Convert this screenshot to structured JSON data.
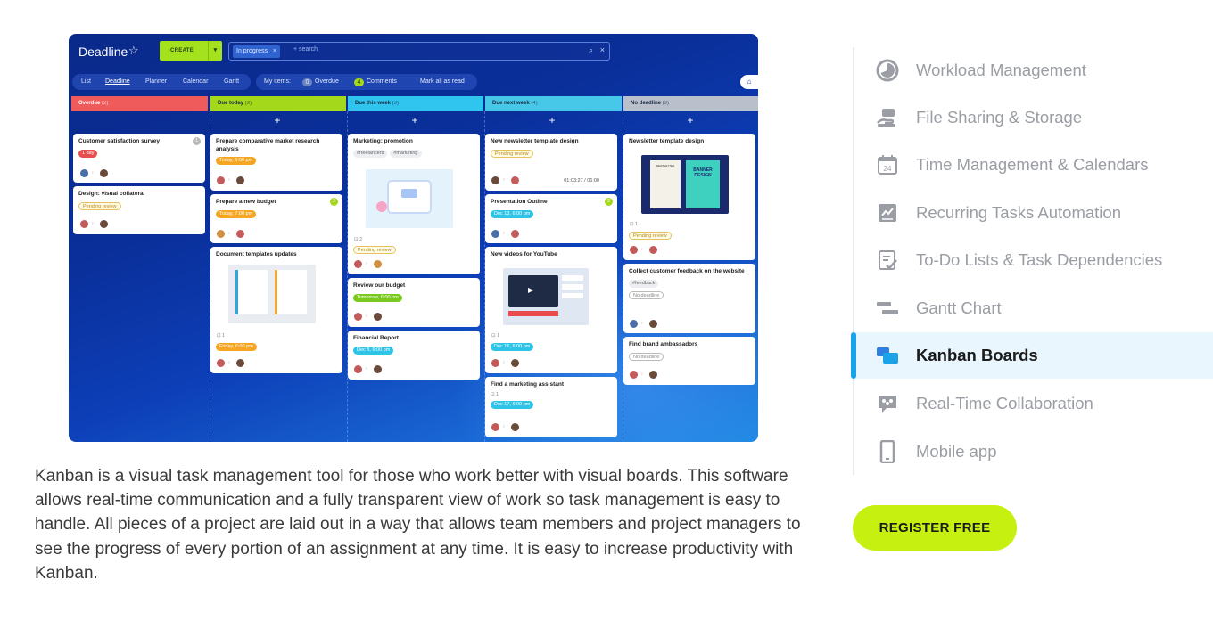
{
  "app": {
    "title": "Deadline",
    "create_label": "CREATE",
    "filter_chip": "In progress",
    "search_placeholder": "+ search",
    "tabs": [
      "List",
      "Deadline",
      "Planner",
      "Calendar",
      "Gantt"
    ],
    "my_items_label": "My items:",
    "overdue_count": "0",
    "overdue_label": "Overdue",
    "comments_count": "4",
    "comments_label": "Comments",
    "mark_all_label": "Mark all as read",
    "columns": [
      {
        "name": "Overdue",
        "count": "(2)",
        "color": "#ef5a5a"
      },
      {
        "name": "Due today",
        "count": "(3)",
        "color": "#a3d81b"
      },
      {
        "name": "Due this week",
        "count": "(3)",
        "color": "#2fc5ee"
      },
      {
        "name": "Due next week",
        "count": "(4)",
        "color": "#48c8e8"
      },
      {
        "name": "No deadline",
        "count": "(3)",
        "color": "#b9c0cc"
      }
    ],
    "cards": {
      "c1": {
        "title": "Customer satisfaction survey",
        "tag": "1 day",
        "badge": "1"
      },
      "c2": {
        "title": "Design: visual collateral",
        "tag": "Pending review"
      },
      "c3": {
        "title": "Prepare comparative market research analysis",
        "tag": "Today, 6:00 pm"
      },
      "c4": {
        "title": "Prepare a new budget",
        "tag": "Today, 7:00 pm",
        "badge": "2"
      },
      "c5": {
        "title": "Document templates updates",
        "sub": "1",
        "tag": "Friday, 6:00 pm"
      },
      "c6": {
        "title": "Marketing: promotion",
        "hash1": "#freelancers",
        "hash2": "#marketing",
        "sub": "2",
        "tag": "Pending review"
      },
      "c7": {
        "title": "Review our budget",
        "tag": "Tomorrow, 6:00 pm"
      },
      "c8": {
        "title": "Financial Report",
        "tag": "Dec 8, 6:00 pm"
      },
      "c9": {
        "title": "New newsletter template design",
        "tag": "Pending review",
        "timer": "01:03:27 / 06:00"
      },
      "c10": {
        "title": "Presentation Outline",
        "tag": "Dec 13, 6:00 pm",
        "badge": "2"
      },
      "c11": {
        "title": "New videos for YouTube",
        "sub": "1",
        "tag": "Dec 16, 6:00 pm"
      },
      "c12": {
        "title": "Find a marketing assistant",
        "sub": "1",
        "tag": "Dec 17, 6:00 pm"
      },
      "c13": {
        "title": "Newsletter template design",
        "sub": "1",
        "tag": "Pending review",
        "img_text1": "NEWSLETTER",
        "img_text2": "BANNER DESIGN"
      },
      "c14": {
        "title": "Collect customer feedback on the website",
        "hash1": "#feedback",
        "tag": "No deadline"
      },
      "c15": {
        "title": "Find brand ambassadors",
        "tag": "No deadline"
      }
    }
  },
  "description": "Kanban is a visual task management tool for those who work better with visual boards. This software allows real-time communication and a fully transparent view of work so task management is easy to handle. All pieces of a project are laid out in a way that allows team members and project managers to see the progress of every portion of an assignment at any time. It is easy to increase productivity with Kanban.",
  "features": [
    {
      "label": "Workload Management",
      "icon": "workload-icon"
    },
    {
      "label": "File Sharing & Storage",
      "icon": "file-sharing-icon"
    },
    {
      "label": "Time Management & Calendars",
      "icon": "calendar-icon"
    },
    {
      "label": "Recurring Tasks Automation",
      "icon": "recurring-icon"
    },
    {
      "label": "To-Do Lists & Task Dependencies",
      "icon": "todo-icon"
    },
    {
      "label": "Gantt Chart",
      "icon": "gantt-icon"
    },
    {
      "label": "Kanban Boards",
      "icon": "kanban-icon",
      "active": true
    },
    {
      "label": "Real-Time Collaboration",
      "icon": "collaboration-icon"
    },
    {
      "label": "Mobile app",
      "icon": "mobile-icon"
    }
  ],
  "calendar_icon_day": "24",
  "register_label": "REGISTER FREE",
  "colors": {
    "accent_blue": "#1aa3e8",
    "register_green": "#c6f00f",
    "app_blue": "#0a2f9a"
  }
}
